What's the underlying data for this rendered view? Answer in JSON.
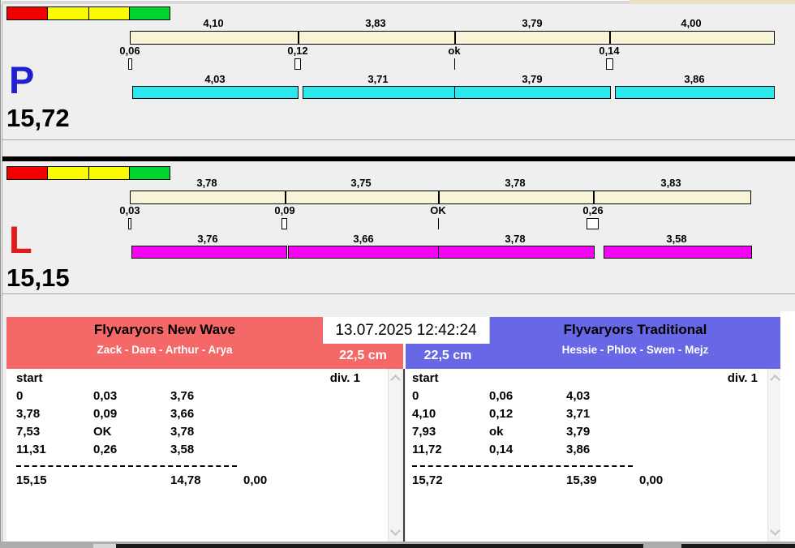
{
  "datetime": "13.07.2025 12:42:24",
  "chart_data": {
    "type": "bar",
    "subtype": "relay-exchange-lanes",
    "track_color": "#F8F4D8",
    "scale_colors": [
      "#F20000",
      "#FAFA00",
      "#FAFA00",
      "#00D42E"
    ],
    "lanes": [
      {
        "id": "P",
        "letter": "P",
        "letter_color": "#2020CF",
        "total_label": "15,72",
        "total_seconds": 15.72,
        "bar_color": "#2BE8EF",
        "legs": [
          {
            "value": 4.1,
            "label": "4,10"
          },
          {
            "value": 3.83,
            "label": "3,83"
          },
          {
            "value": 3.79,
            "label": "3,79"
          },
          {
            "value": 4.0,
            "label": "4,00"
          }
        ],
        "exchanges": [
          {
            "gap": 0.06,
            "label": "0,06"
          },
          {
            "gap": 0.12,
            "label": "0,12"
          },
          {
            "gap": 0,
            "label": "ok"
          },
          {
            "gap": 0.14,
            "label": "0,14"
          }
        ],
        "runs": [
          {
            "value": 4.03,
            "label": "4,03"
          },
          {
            "value": 3.71,
            "label": "3,71"
          },
          {
            "value": 3.79,
            "label": "3,79"
          },
          {
            "value": 3.86,
            "label": "3,86"
          }
        ]
      },
      {
        "id": "L",
        "letter": "L",
        "letter_color": "#E11B1B",
        "total_label": "15,15",
        "total_seconds": 15.15,
        "bar_color": "#F404F4",
        "legs": [
          {
            "value": 3.78,
            "label": "3,78"
          },
          {
            "value": 3.75,
            "label": "3,75"
          },
          {
            "value": 3.78,
            "label": "3,78"
          },
          {
            "value": 3.83,
            "label": "3,83"
          }
        ],
        "exchanges": [
          {
            "gap": 0.03,
            "label": "0,03"
          },
          {
            "gap": 0.09,
            "label": "0,09"
          },
          {
            "gap": 0,
            "label": "OK"
          },
          {
            "gap": 0.26,
            "label": "0,26"
          }
        ],
        "runs": [
          {
            "value": 3.76,
            "label": "3,76"
          },
          {
            "value": 3.66,
            "label": "3,66"
          },
          {
            "value": 3.78,
            "label": "3,78"
          },
          {
            "value": 3.58,
            "label": "3,58"
          }
        ]
      }
    ]
  },
  "teams": [
    {
      "title": "Flyvaryors New Wave",
      "members": "Zack - Dara - Arthur - Arya",
      "distance": "22,5 cm",
      "header_color": "#F56868",
      "table": {
        "header_left": "start",
        "header_right": "div.  1",
        "rows": [
          [
            "0",
            "0,03",
            "3,76"
          ],
          [
            "3,78",
            "0,09",
            "3,66"
          ],
          [
            "7,53",
            "OK",
            "3,78"
          ],
          [
            "11,31",
            "0,26",
            "3,58"
          ]
        ],
        "totals": [
          "15,15",
          "14,78",
          "0,00"
        ]
      }
    },
    {
      "title": "Flyvaryors Traditional",
      "members": "Hessie - Phlox - Swen - Mejz",
      "distance": "22,5 cm",
      "header_color": "#6867E6",
      "table": {
        "header_left": "start",
        "header_right": "div.  1",
        "rows": [
          [
            "0",
            "0,06",
            "4,03"
          ],
          [
            "4,10",
            "0,12",
            "3,71"
          ],
          [
            "7,93",
            "ok",
            "3,79"
          ],
          [
            "11,72",
            "0,14",
            "3,86"
          ]
        ],
        "totals": [
          "15,72",
          "15,39",
          "0,00"
        ]
      }
    }
  ]
}
